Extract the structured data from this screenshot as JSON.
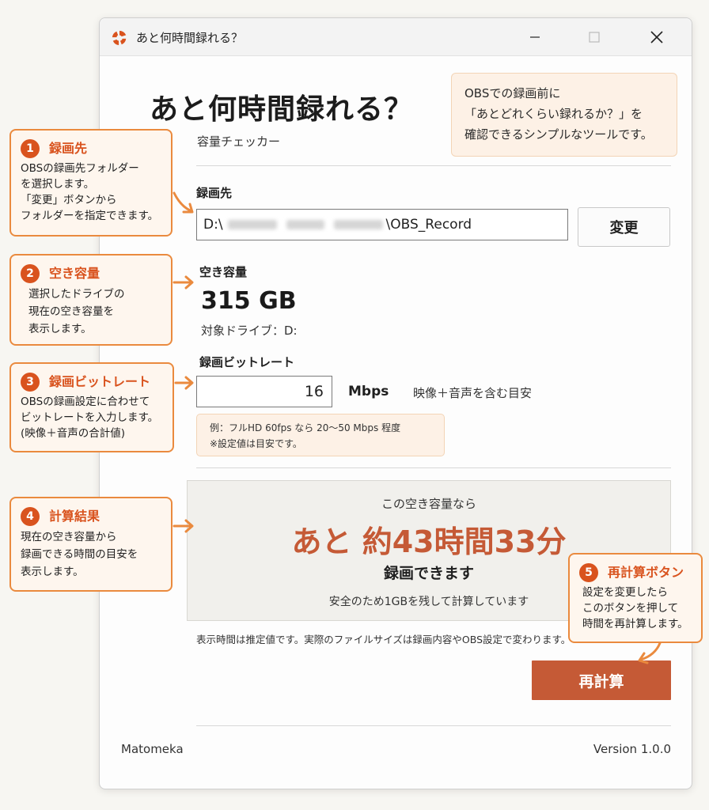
{
  "window": {
    "title": "あと何時間録れる？",
    "icon": "app-swirl-icon",
    "accent_color": "#c55a36"
  },
  "header": {
    "title": "あと何時間録れる？",
    "subtitle": "容量チェッカー",
    "info_lines": [
      "OBSでの録画前に",
      "「あとどれくらい録れるか？」を",
      "確認できるシンプルなツールです。"
    ]
  },
  "folder": {
    "label": "録画先",
    "path_prefix": "D:\\",
    "path_suffix": "\\OBS_Record",
    "change_button": "変更"
  },
  "free_space": {
    "label": "空き容量",
    "value": "315 GB",
    "drive": "対象ドライブ：D:"
  },
  "bitrate": {
    "label": "録画ビットレート",
    "value": "16",
    "unit": "Mbps",
    "note": "映像＋音声を含む目安",
    "example_lines": [
      "例：フルHD 60fps なら 20〜50 Mbps 程度",
      "※設定値は目安です。"
    ]
  },
  "result": {
    "lead": "この空き容量なら",
    "main": "あと 約43時間33分",
    "sub": "録画できます",
    "note": "安全のため1GBを残して計算しています"
  },
  "disclaimer": "表示時間は推定値です。実際のファイルサイズは録画内容やOBS設定で変わります。",
  "recalc_button": "再計算",
  "footer": {
    "left": "Matomeka",
    "right": "Version 1.0.0"
  },
  "callouts": [
    {
      "num": "1",
      "title": "録画先",
      "lines": [
        "OBSの録画先フォルダー",
        "を選択します。",
        "「変更」ボタンから",
        "フォルダーを指定できます。"
      ]
    },
    {
      "num": "2",
      "title": "空き容量",
      "lines": [
        "選択したドライブの",
        "現在の空き容量を",
        "表示します。"
      ]
    },
    {
      "num": "3",
      "title": "録画ビットレート",
      "lines": [
        "OBSの録画設定に合わせて",
        "ビットレートを入力します。",
        "(映像＋音声の合計値)"
      ]
    },
    {
      "num": "4",
      "title": "計算結果",
      "lines": [
        "現在の空き容量から",
        "録画できる時間の目安を",
        "表示します。"
      ]
    },
    {
      "num": "5",
      "title": "再計算ボタン",
      "lines": [
        "設定を変更したら",
        "このボタンを押して",
        "時間を再計算します。"
      ]
    }
  ],
  "colors": {
    "callout_border": "#ea8a3e",
    "callout_number": "#d9531e",
    "info_background": "#fdf1e6"
  }
}
